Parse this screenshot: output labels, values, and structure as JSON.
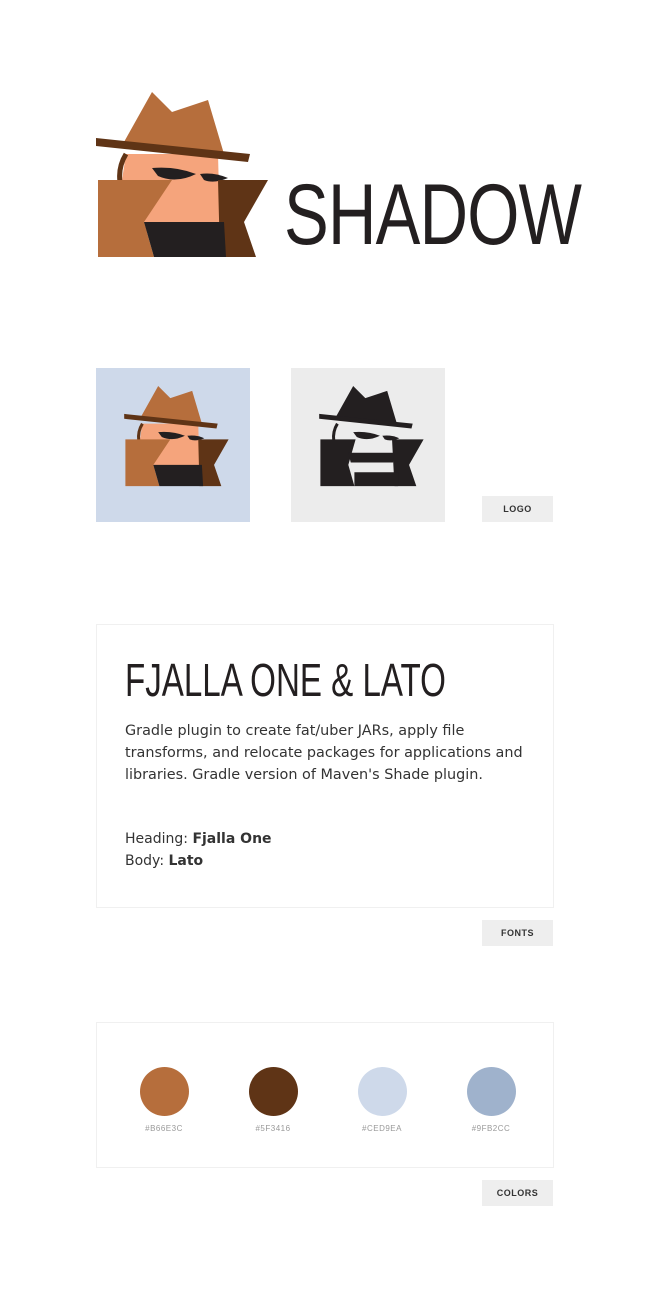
{
  "brand": {
    "wordmark": "SHADOW"
  },
  "logo_section": {
    "tag": "LOGO"
  },
  "fonts_section": {
    "heading": "FJALLA ONE & LATO",
    "body": "Gradle plugin to create fat/uber JARs, apply file transforms, and relocate packages for applications and libraries. Gradle version of Maven's Shade plugin.",
    "heading_label": "Heading: ",
    "heading_font": "Fjalla One",
    "body_label": "Body: ",
    "body_font": "Lato",
    "tag": "FONTS"
  },
  "colors_section": {
    "swatches": [
      {
        "hex": "#B66E3C",
        "label": "#B66E3C"
      },
      {
        "hex": "#5F3416",
        "label": "#5F3416"
      },
      {
        "hex": "#CED9EA",
        "label": "#CED9EA"
      },
      {
        "hex": "#9FB2CC",
        "label": "#9FB2CC"
      }
    ],
    "tag": "COLORS"
  },
  "palette": {
    "hat": "#B66E3C",
    "hat_band": "#5F3416",
    "face": "#F5A47C",
    "dark": "#231f20",
    "tile_blue": "#CED9EA",
    "tile_grey": "#ececec"
  }
}
